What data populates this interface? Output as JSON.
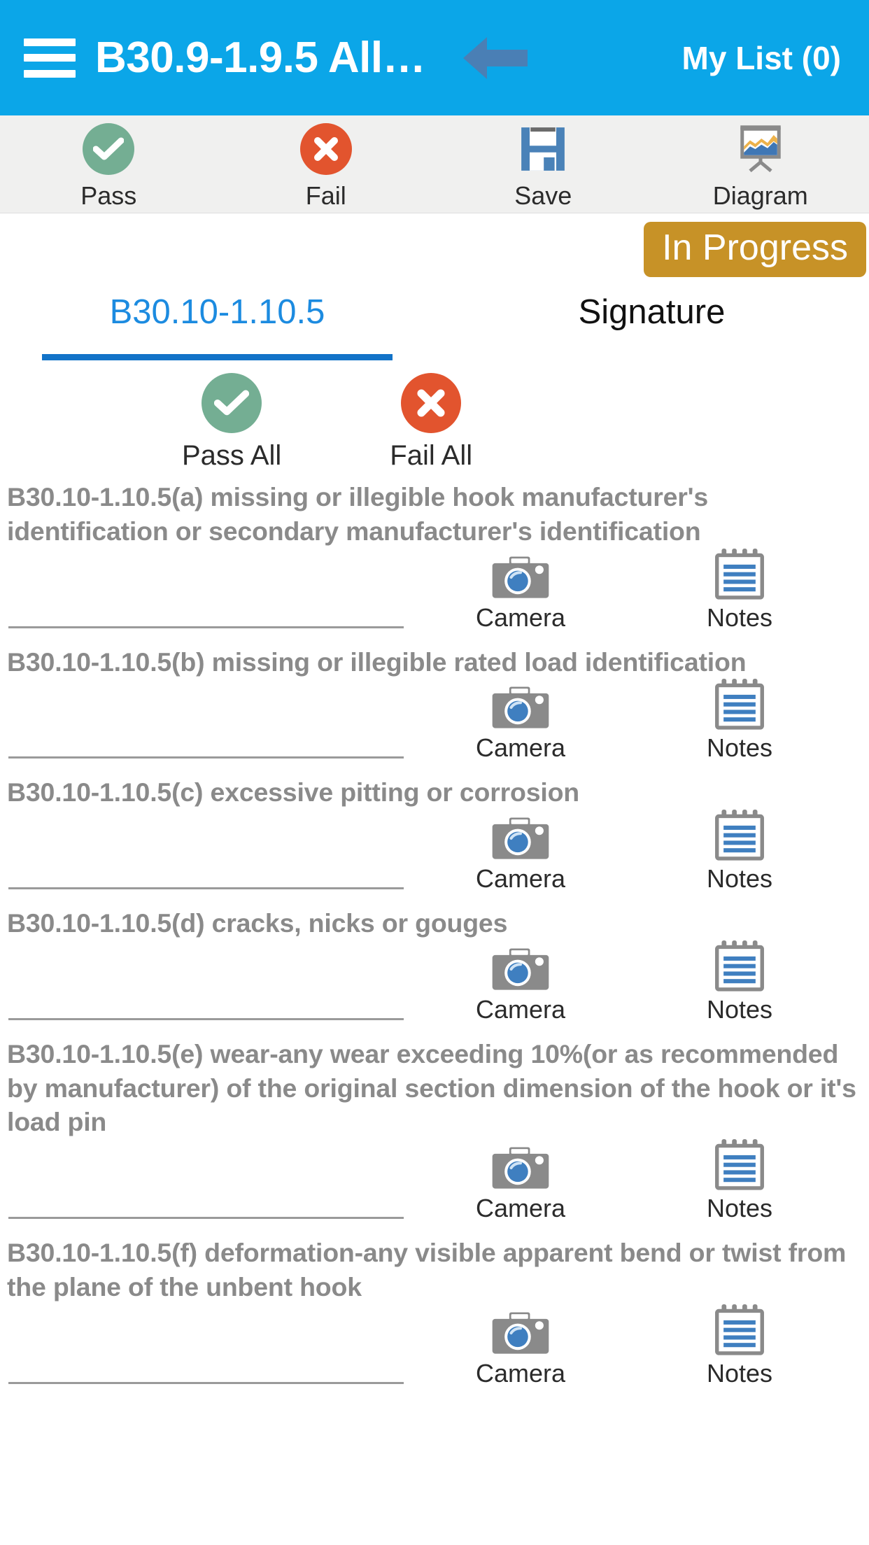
{
  "header": {
    "menu_icon": "hamburger-menu-icon",
    "title": "B30.9-1.9.5 All…",
    "back_icon": "back-arrow-icon",
    "my_list_label": "My List (0)",
    "background_color": "#0BA6E8"
  },
  "toolbar": {
    "items": [
      {
        "label": "Pass",
        "icon": "check-circle-icon",
        "color": "#74AE93"
      },
      {
        "label": "Fail",
        "icon": "x-circle-icon",
        "color": "#E2542E"
      },
      {
        "label": "Save",
        "icon": "floppy-disk-icon",
        "color": "#4A82B8"
      },
      {
        "label": "Diagram",
        "icon": "presentation-chart-icon",
        "color": "#808080"
      }
    ],
    "background_color": "#F0F0EF"
  },
  "status": {
    "badge_label": "In Progress",
    "badge_color": "#C79227",
    "badge_text_color": "#FFFFFF"
  },
  "tabs": [
    {
      "label": "B30.10-1.10.5",
      "active": true,
      "color": "#1C8BE0"
    },
    {
      "label": "Signature",
      "active": false,
      "color": "#111111"
    }
  ],
  "bulk_actions": [
    {
      "label": "Pass All",
      "icon": "check-circle-icon",
      "color": "#74AE93"
    },
    {
      "label": "Fail All",
      "icon": "x-circle-icon",
      "color": "#E2542E"
    }
  ],
  "row_actions": {
    "camera_label": "Camera",
    "camera_icon": "camera-icon",
    "notes_label": "Notes",
    "notes_icon": "notepad-icon",
    "input_value": "",
    "input_placeholder": ""
  },
  "items": [
    {
      "text": "B30.10-1.10.5(a) missing or illegible hook manufacturer's identification or secondary manufacturer's identification",
      "value": ""
    },
    {
      "text": "B30.10-1.10.5(b) missing or illegible rated load identification",
      "value": ""
    },
    {
      "text": "B30.10-1.10.5(c) excessive pitting or corrosion",
      "value": ""
    },
    {
      "text": "B30.10-1.10.5(d) cracks, nicks or gouges",
      "value": ""
    },
    {
      "text": "B30.10-1.10.5(e) wear-any wear exceeding 10%(or as recommended by manufacturer) of the original section dimension of the hook or it's load pin",
      "value": ""
    },
    {
      "text": "B30.10-1.10.5(f) deformation-any visible apparent bend or twist from the plane of the unbent hook",
      "value": ""
    }
  ]
}
